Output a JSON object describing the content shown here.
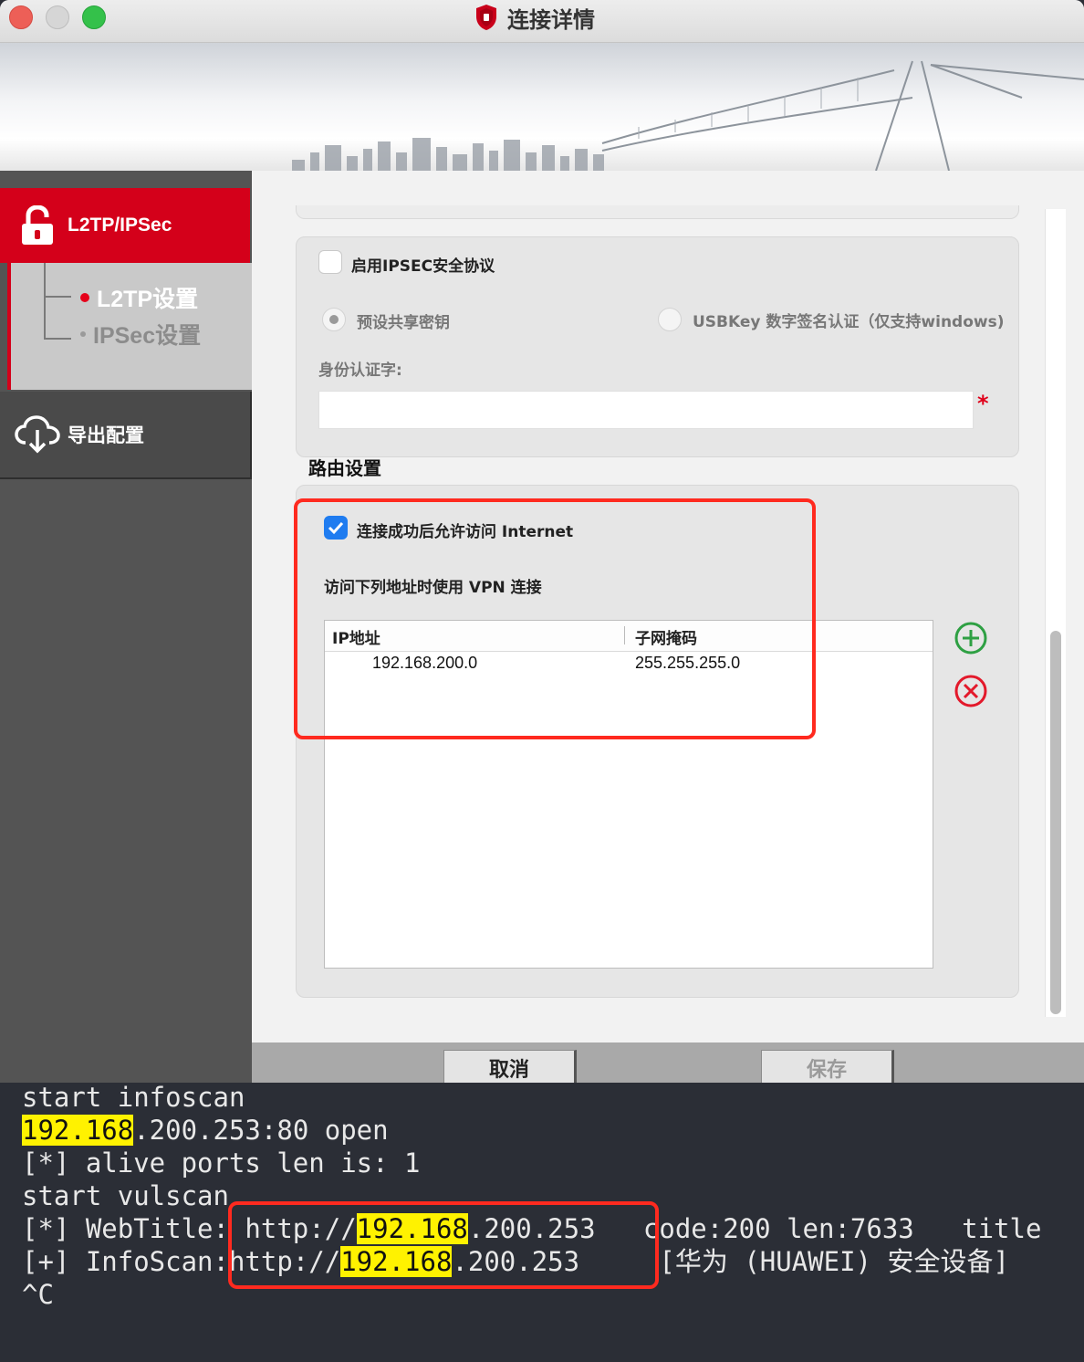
{
  "window": {
    "title": "连接详情"
  },
  "sidebar": {
    "active_item": "L2TP/IPSec",
    "sub_items": [
      {
        "label": "L2TP设置",
        "selected": true
      },
      {
        "label": "IPSec设置",
        "selected": false
      }
    ],
    "export_item": "导出配置"
  },
  "ipsec_panel": {
    "enable_label": "启用IPSEC安全协议",
    "enable_checked": false,
    "radio_psk": "预设共享密钥",
    "radio_usbkey": "USBKey 数字签名认证（仅支持windows)",
    "identity_label": "身份认证字:",
    "identity_value": "",
    "required_mark": "*"
  },
  "routing": {
    "section_title": "路由设置",
    "allow_internet_label": "连接成功后允许访问 Internet",
    "allow_internet_checked": true,
    "vpn_label": "访问下列地址时使用 VPN 连接",
    "columns": [
      "IP地址",
      "子网掩码"
    ],
    "rows": [
      {
        "ip": "192.168.200.0",
        "mask": "255.255.255.0"
      }
    ],
    "add_icon": "plus-circle-icon",
    "delete_icon": "x-circle-icon"
  },
  "footer": {
    "cancel": "取消",
    "save": "保存"
  },
  "terminal": {
    "line1": "start infoscan",
    "line2_hl": "192.168",
    "line2_rest": ".200.253:80 open",
    "line3": "[*] alive ports len is: 1",
    "line4": "start vulscan",
    "line5_pre": "[*] WebTitle: http://",
    "line5_hl": "192.168",
    "line5_rest": ".200.253   code:200 len:7633   title",
    "line6_pre": "[+] InfoScan:http://",
    "line6_hl": "192.168",
    "line6_rest": ".200.253     [华为 (HUAWEI) 安全设备]",
    "line7": "^C"
  },
  "colors": {
    "accent_red": "#d4001a",
    "highlight_box": "#ff2a1f",
    "checkbox_blue": "#1f7cf0",
    "terminal_bg": "#2b2e36",
    "terminal_highlight": "#fff200"
  }
}
